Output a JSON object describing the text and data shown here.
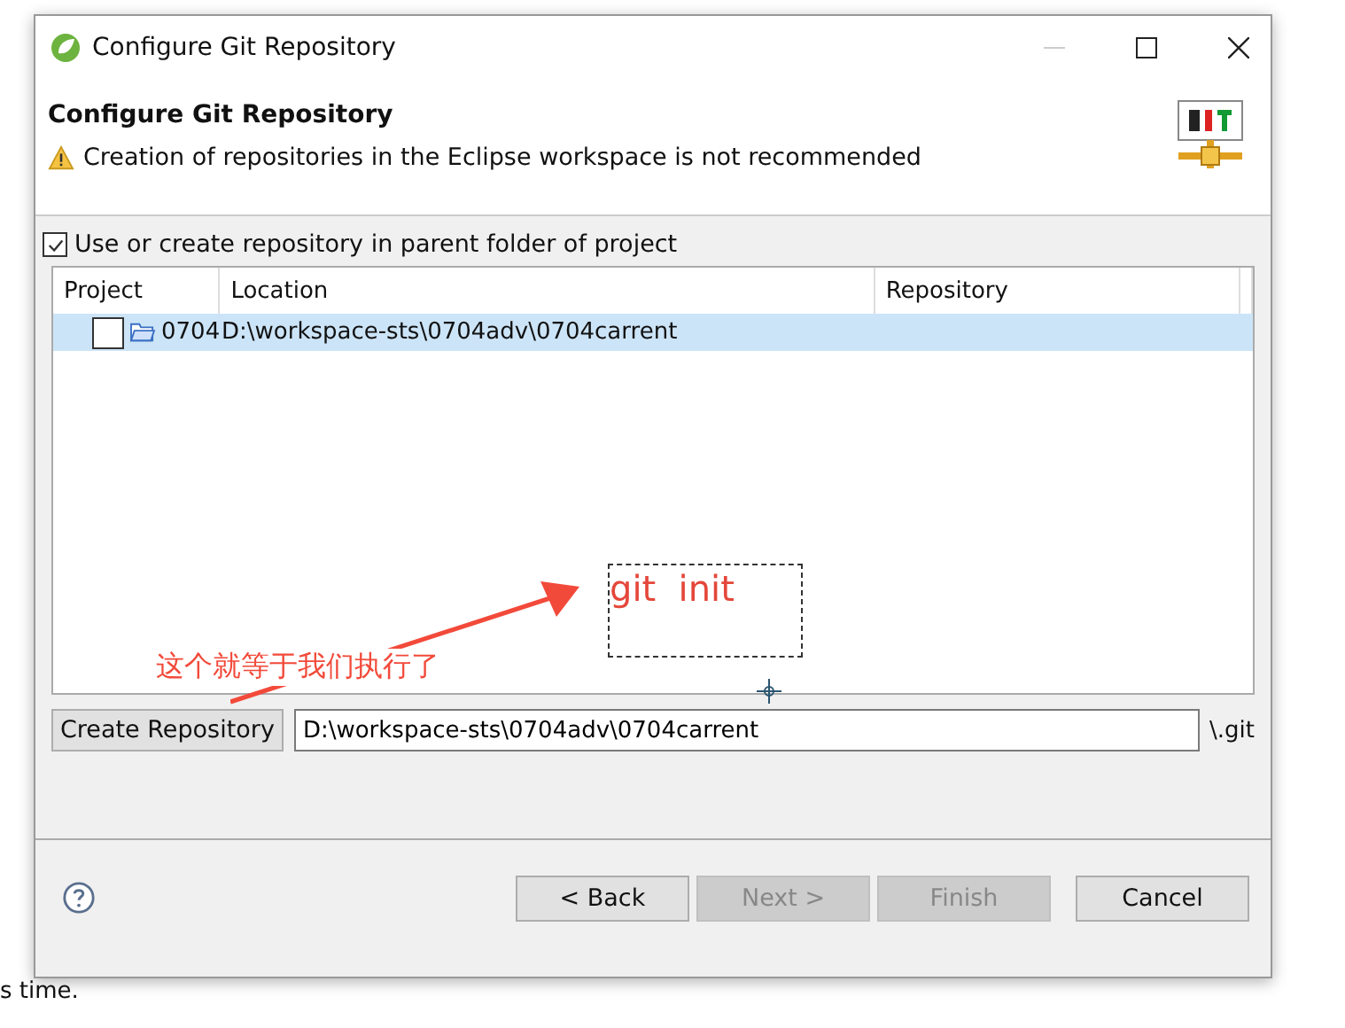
{
  "window": {
    "title": "Configure Git Repository"
  },
  "header": {
    "title": "Configure Git Repository",
    "warning": "Creation of repositories in the Eclipse workspace is not recommended"
  },
  "parent_folder_option": {
    "label": "Use or create repository in parent folder of project",
    "checked": true
  },
  "table": {
    "columns": [
      "Project",
      "Location",
      "Repository"
    ],
    "rows": [
      {
        "project": "0704",
        "location": "D:\\workspace-sts\\0704adv\\0704carrent",
        "repository": "",
        "checked": false,
        "selected": true
      }
    ]
  },
  "create_button": "Create Repository",
  "path_field": {
    "value": "D:\\workspace-sts\\0704adv\\0704carrent"
  },
  "path_suffix": "\\.git",
  "annotations": {
    "callout": "这个就等于我们执行了",
    "command": "git  init"
  },
  "buttons": [
    {
      "label": "< Back",
      "disabled": false
    },
    {
      "label": "Next >",
      "disabled": true
    },
    {
      "label": "Finish",
      "disabled": true
    },
    {
      "label": "Cancel",
      "disabled": false
    }
  ],
  "background_text": "s time."
}
